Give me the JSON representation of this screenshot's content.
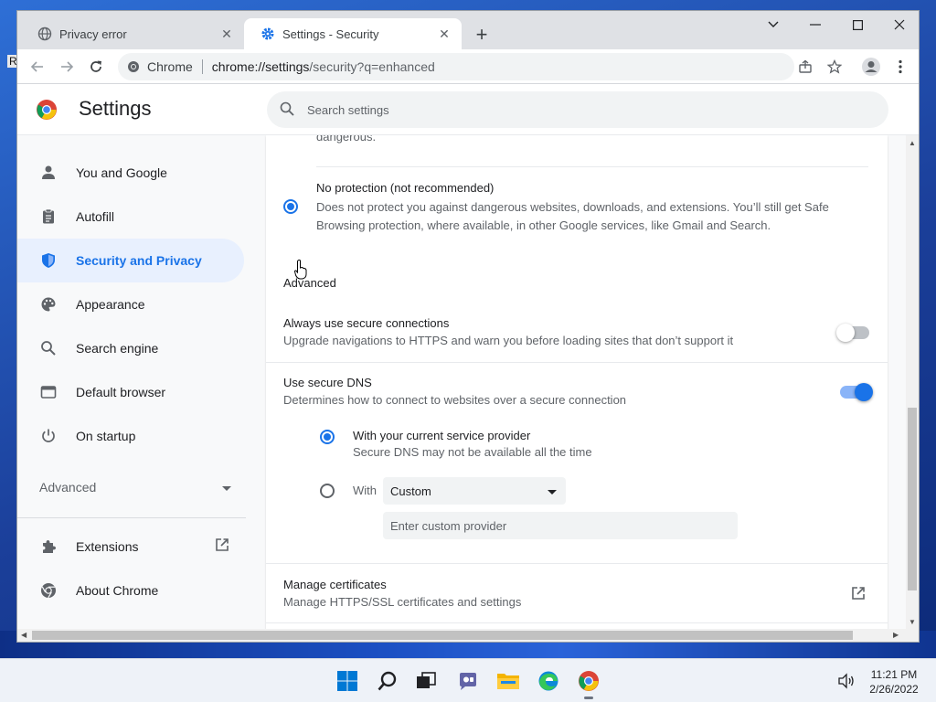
{
  "desktop": {
    "stub_label": "R"
  },
  "browser": {
    "tabs": [
      {
        "title": "Privacy error",
        "icon": "globe-icon",
        "active": false
      },
      {
        "title": "Settings - Security",
        "icon": "gear-icon",
        "active": true
      }
    ],
    "omnibox": {
      "chip": "Chrome",
      "url_host": "chrome://settings",
      "url_path": "/security?q=enhanced"
    }
  },
  "settings": {
    "title": "Settings",
    "search_placeholder": "Search settings",
    "sidebar": {
      "items": [
        {
          "label": "You and Google",
          "icon": "person-icon",
          "selected": false
        },
        {
          "label": "Autofill",
          "icon": "clipboard-icon",
          "selected": false
        },
        {
          "label": "Security and Privacy",
          "icon": "shield-icon",
          "selected": true
        },
        {
          "label": "Appearance",
          "icon": "palette-icon",
          "selected": false
        },
        {
          "label": "Search engine",
          "icon": "search-icon",
          "selected": false
        },
        {
          "label": "Default browser",
          "icon": "browser-window-icon",
          "selected": false
        },
        {
          "label": "On startup",
          "icon": "power-icon",
          "selected": false
        }
      ],
      "advanced_label": "Advanced",
      "bottom_items": [
        {
          "label": "Extensions",
          "icon": "puzzle-icon"
        },
        {
          "label": "About Chrome",
          "icon": "chrome-icon"
        }
      ]
    },
    "content": {
      "clipped_text": "dangerous.",
      "no_protection": {
        "title": "No protection (not recommended)",
        "desc_line1": "Does not protect you against dangerous websites, downloads, and extensions. You’ll still get Safe",
        "desc_line2": "Browsing protection, where available, in other Google services, like Gmail and Search."
      },
      "advanced_heading": "Advanced",
      "secure_connections": {
        "title": "Always use secure connections",
        "desc": "Upgrade navigations to HTTPS and warn you before loading sites that don’t support it",
        "enabled": false
      },
      "secure_dns": {
        "title": "Use secure DNS",
        "desc": "Determines how to connect to websites over a secure connection",
        "enabled": true,
        "option_current": {
          "title": "With your current service provider",
          "desc": "Secure DNS may not be available all the time"
        },
        "option_custom_label": "With",
        "custom_select_value": "Custom",
        "custom_provider_placeholder": "Enter custom provider"
      },
      "certificates": {
        "title": "Manage certificates",
        "desc": "Manage HTTPS/SSL certificates and settings"
      }
    }
  },
  "taskbar": {
    "time": "11:21 PM",
    "date": "2/26/2022"
  },
  "colors": {
    "accent": "#1a73e8",
    "selected_bg": "#e8f0fe",
    "text_primary": "#202124",
    "text_secondary": "#5f6368"
  }
}
